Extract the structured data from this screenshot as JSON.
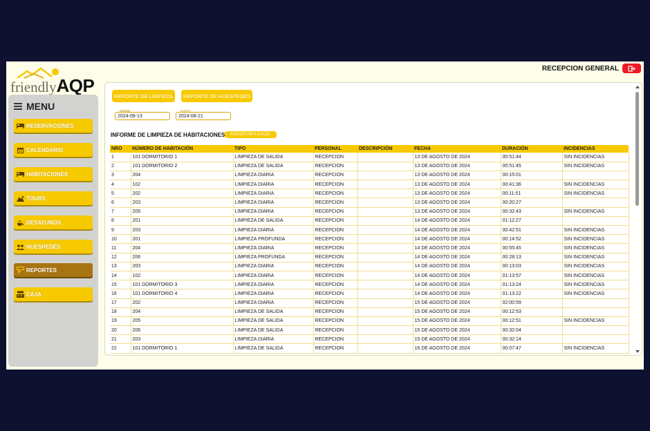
{
  "logo": {
    "prefix": "friendly",
    "brand": "AQP"
  },
  "header": {
    "user_label": "RECEPCION GENERAL",
    "logout_icon": "logout-icon",
    "logout_color": "#ee1b24"
  },
  "colors": {
    "accent": "#f7c900",
    "active": "#a87412",
    "background": "#fdfde9"
  },
  "sidebar": {
    "menu_label": "MENU",
    "items": [
      {
        "label": "RESERVACIONES",
        "icon": "bed-icon"
      },
      {
        "label": "CALENDARIO",
        "icon": "calendar-icon"
      },
      {
        "label": "HABITACIONES",
        "icon": "bed-icon"
      },
      {
        "label": "TOURS",
        "icon": "mountain-icon"
      },
      {
        "label": "DESAYUNOS",
        "icon": "breakfast-icon"
      },
      {
        "label": "HUESPEDES",
        "icon": "users-icon"
      },
      {
        "label": "REPORTES",
        "icon": "report-icon",
        "active": true
      },
      {
        "label": "CAJA",
        "icon": "cash-register-icon"
      }
    ]
  },
  "tabs": {
    "cleaning": "REPORTE DE LIMPIEZA",
    "guests": "REPORTE DE HUESPEDES"
  },
  "filters": {
    "from_label": "DESDE",
    "from_value": "2024-08-13",
    "to_label": "HASTA",
    "to_value": "2024-08-21"
  },
  "report": {
    "title": "INFORME DE LIMPIEZA DE HABITACIONES",
    "export_label": "EXPORTAR A EXCEL"
  },
  "table": {
    "columns": [
      "NRO",
      "NÚMERO DE HABITACIÓN",
      "TIPO",
      "PERSONAL",
      "DESCRIPCIÓN",
      "FECHA",
      "DURACIÓN",
      "INCIDENCIAS"
    ],
    "rows": [
      [
        "1",
        "101 DORMITORIO 1",
        "LIMPIEZA DE SALIDA",
        "RECEPCION",
        "",
        "13 DE AGOSTO DE 2024",
        "00:51:44",
        "SIN INCIDENCIAS"
      ],
      [
        "2",
        "101 DORMITORIO 2",
        "LIMPIEZA DE SALIDA",
        "RECEPCION",
        "",
        "13 DE AGOSTO DE 2024",
        "00:51:45",
        "SIN INCIDENCIAS"
      ],
      [
        "3",
        "204",
        "LIMPIEZA DIARIA",
        "RECEPCION",
        "",
        "13 DE AGOSTO DE 2024",
        "00:15:01",
        ""
      ],
      [
        "4",
        "102",
        "LIMPIEZA DIARIA",
        "RECEPCION",
        "",
        "13 DE AGOSTO DE 2024",
        "00:41:36",
        "SIN INCIDENCIAS"
      ],
      [
        "5",
        "202",
        "LIMPIEZA DIARIA",
        "RECEPCION",
        "",
        "13 DE AGOSTO DE 2024",
        "00:11:01",
        "SIN INCIDENCIAS"
      ],
      [
        "6",
        "203",
        "LIMPIEZA DIARIA",
        "RECEPCION",
        "",
        "13 DE AGOSTO DE 2024",
        "00:20:27",
        ""
      ],
      [
        "7",
        "205",
        "LIMPIEZA DIARIA",
        "RECEPCION",
        "",
        "13 DE AGOSTO DE 2024",
        "00:32:43",
        "SIN INCIDENCIAS"
      ],
      [
        "8",
        "201",
        "LIMPIEZA DE SALIDA",
        "RECEPCION",
        "",
        "14 DE AGOSTO DE 2024",
        "01:12:27",
        ""
      ],
      [
        "9",
        "203",
        "LIMPIEZA DIARIA",
        "RECEPCION",
        "",
        "14 DE AGOSTO DE 2024",
        "00:42:51",
        "SIN INCIDENCIAS"
      ],
      [
        "10",
        "201",
        "LIMPIEZA PROFUNDA",
        "RECEPCION",
        "",
        "14 DE AGOSTO DE 2024",
        "00:14:52",
        "SIN INCIDENCIAS"
      ],
      [
        "11",
        "204",
        "LIMPIEZA DIARIA",
        "RECEPCION",
        "",
        "14 DE AGOSTO DE 2024",
        "00:55:45",
        "SIN INCIDENCIAS"
      ],
      [
        "12",
        "206",
        "LIMPIEZA PROFUNDA",
        "RECEPCION",
        "",
        "14 DE AGOSTO DE 2024",
        "00:28:13",
        "SIN INCIDENCIAS"
      ],
      [
        "13",
        "203",
        "LIMPIEZA DIARIA",
        "RECEPCION",
        "",
        "14 DE AGOSTO DE 2024",
        "00:13:03",
        "SIN INCIDENCIAS"
      ],
      [
        "14",
        "102",
        "LIMPIEZA DIARIA",
        "RECEPCION",
        "",
        "14 DE AGOSTO DE 2024",
        "01:13:57",
        "SIN INCIDENCIAS"
      ],
      [
        "15",
        "101 DORMITORIO 3",
        "LIMPIEZA DIARIA",
        "RECEPCION",
        "",
        "14 DE AGOSTO DE 2024",
        "01:13:24",
        "SIN INCIDENCIAS"
      ],
      [
        "16",
        "101 DORMITORIO 4",
        "LIMPIEZA DIARIA",
        "RECEPCION",
        "",
        "14 DE AGOSTO DE 2024",
        "01:13:22",
        "SIN INCIDENCIAS"
      ],
      [
        "17",
        "202",
        "LIMPIEZA DIARIA",
        "RECEPCION",
        "",
        "15 DE AGOSTO DE 2024",
        "02:00:59",
        ""
      ],
      [
        "18",
        "204",
        "LIMPIEZA DE SALIDA",
        "RECEPCION",
        "",
        "15 DE AGOSTO DE 2024",
        "00:12:53",
        ""
      ],
      [
        "19",
        "205",
        "LIMPIEZA DE SALIDA",
        "RECEPCION",
        "",
        "15 DE AGOSTO DE 2024",
        "00:12:51",
        "SIN INCIDENCIAS"
      ],
      [
        "20",
        "206",
        "LIMPIEZA DE SALIDA",
        "RECEPCION",
        "",
        "15 DE AGOSTO DE 2024",
        "00:32:04",
        ""
      ],
      [
        "21",
        "203",
        "LIMPIEZA DIARIA",
        "RECEPCION",
        "",
        "15 DE AGOSTO DE 2024",
        "00:32:14",
        ""
      ],
      [
        "22",
        "101 DORMITORIO 1",
        "LIMPIEZA DE SALIDA",
        "RECEPCION",
        "",
        "16 DE AGOSTO DE 2024",
        "00:07:47",
        "SIN INCIDENCIAS"
      ]
    ]
  }
}
